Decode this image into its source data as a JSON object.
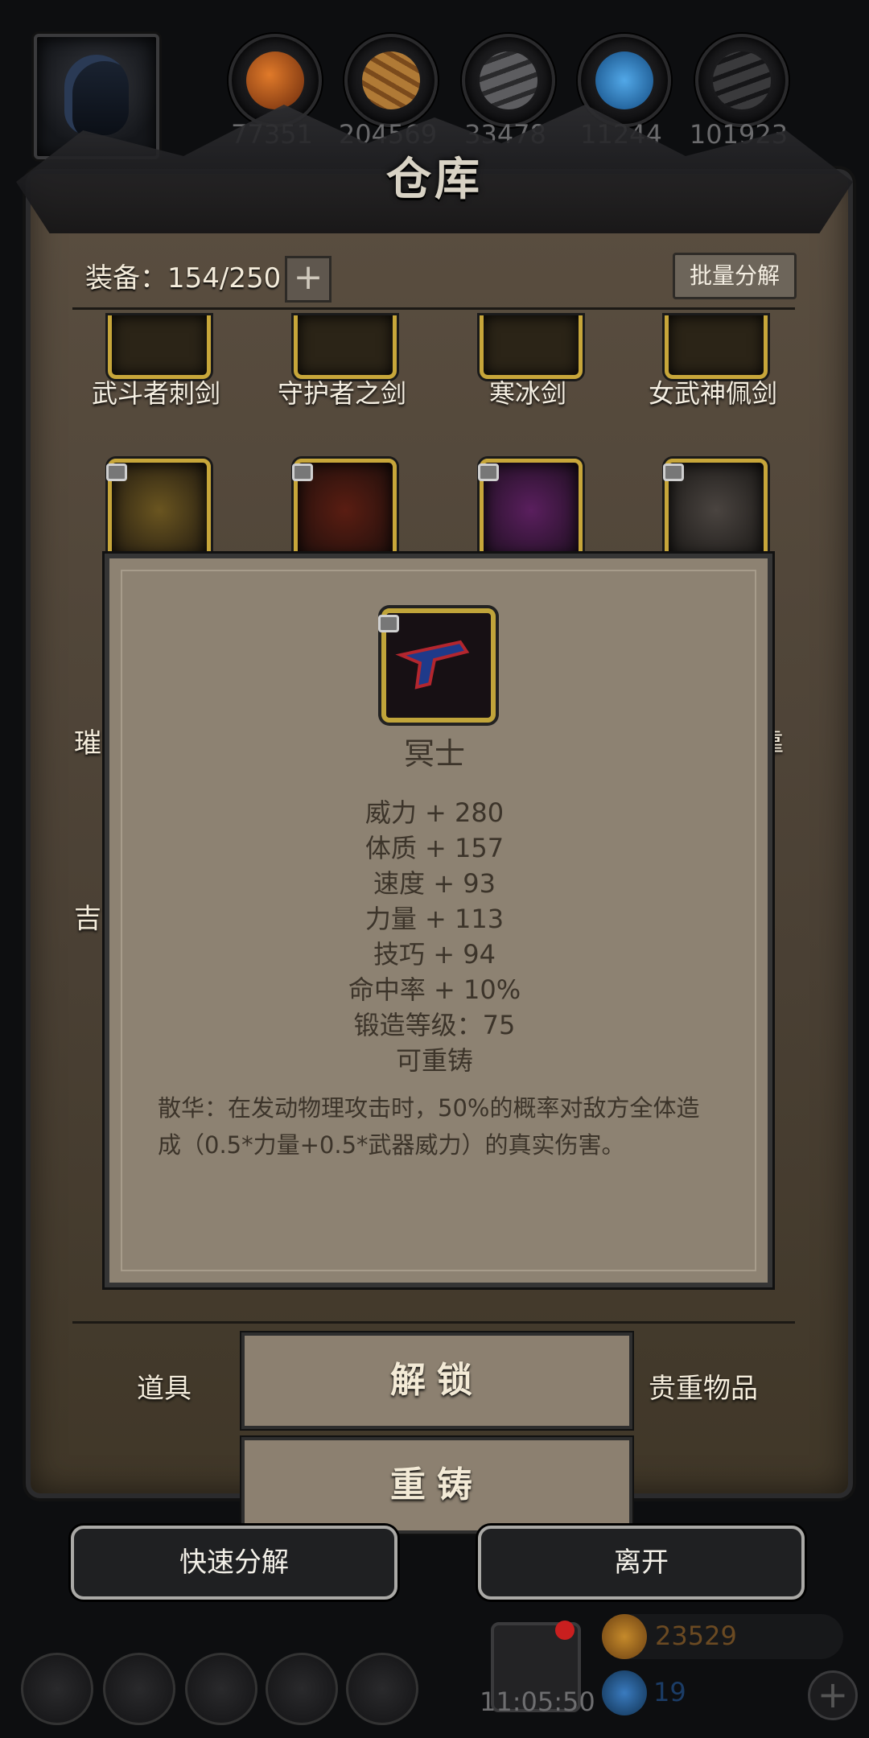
{
  "resources": [
    {
      "name": "orange-ore-icon",
      "count": "77351",
      "color": "#b8541a"
    },
    {
      "name": "wood-icon",
      "count": "204569",
      "color": "#a06a2c"
    },
    {
      "name": "iron-ingot-icon",
      "count": "33478",
      "color": "#5a5a5c"
    },
    {
      "name": "crystal-icon",
      "count": "11244",
      "color": "#1f6eb0"
    },
    {
      "name": "coal-icon",
      "count": "101923",
      "color": "#2e2e30"
    }
  ],
  "panel": {
    "title": "仓库",
    "equip_label": "装备：154/250",
    "plus_label": "+",
    "bulk_button": "批量分解"
  },
  "items_row1": [
    {
      "name": "武斗者刺剑",
      "icon": "dagger-icon"
    },
    {
      "name": "守护者之剑",
      "icon": "greatsword-icon"
    },
    {
      "name": "寒冰剑",
      "icon": "ice-sword-icon"
    },
    {
      "name": "女武神佩剑",
      "icon": "rapier-icon"
    }
  ],
  "items_row2_icons": [
    "golden-axe-icon",
    "crimson-axe-icon",
    "purple-axe-icon",
    "double-axe-icon"
  ],
  "partial_labels": {
    "left_a": "璀",
    "right_a": "靠",
    "left_b": "吉"
  },
  "popup": {
    "icon": "pistol-icon",
    "name": "冥士",
    "stats": [
      "威力 + 280",
      "体质 + 157",
      "速度 + 93",
      "力量 + 113",
      "技巧 + 94",
      "命中率 + 10%",
      "锻造等级：75",
      "可重铸"
    ],
    "description": "散华：在发动物理攻击时，50%的概率对敌方全体造成（0.5*力量+0.5*武器威力）的真实伤害。"
  },
  "actions": {
    "unlock": "解锁",
    "reforge": "重铸"
  },
  "tabs": {
    "items": "道具",
    "valuables": "贵重物品"
  },
  "bottom_buttons": {
    "quick_dismantle": "快速分解",
    "leave": "离开"
  },
  "bottom_bar": {
    "icons": [
      "settings-icon",
      "star-icon",
      "character-icon",
      "mail-icon",
      "swords-icon"
    ],
    "time": "11:05:50",
    "gold": "23529",
    "gems": "19",
    "add_label": "+"
  }
}
